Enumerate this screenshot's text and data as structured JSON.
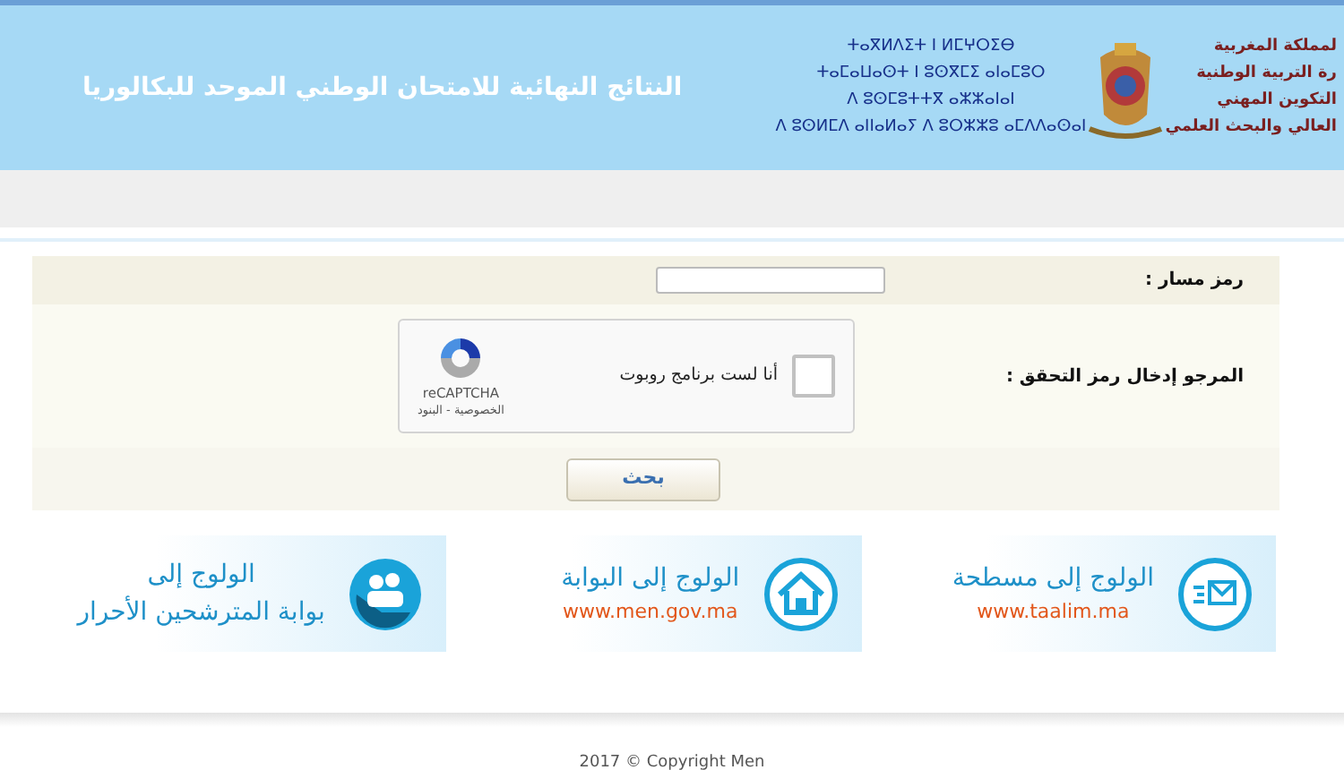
{
  "header": {
    "title": "النتائج النهائية للامتحان الوطني الموحد للبكالوريا",
    "tifinagh_lines": [
      "ⵜⴰⴳⵍⴷⵉⵜ ⵏ ⵍⵎⵖⵔⵉⴱ",
      "ⵜⴰⵎⴰⵡⴰⵙⵜ ⵏ ⵓⵙⴳⵎⵉ ⴰⵏⴰⵎⵓⵔ",
      "ⴷ ⵓⵙⵎⵓⵜⵜⴳ ⴰⵣⵣⴰⵏⴰⵏ",
      "ⴷ ⵓⵙⵍⵎⴷ ⴰⵏⵏⴰⵍⴰⵢ ⴷ ⵓⵔⵣⵣⵓ ⴰⵎⴷⴷⴰⵙⴰⵏ"
    ],
    "arabic_lines": [
      "لمملكة المغربية",
      "رة التربية الوطنية",
      "التكوين المهني",
      "العالي والبحث العلمي"
    ]
  },
  "form": {
    "fields": [
      {
        "kind": "input",
        "label": "رمز مسار :"
      },
      {
        "kind": "captcha",
        "label": "المرجو إدخال رمز التحقق :",
        "captcha": {
          "text": "أنا لست برنامج روبوت",
          "checked": false,
          "brand": "reCAPTCHA",
          "links": "الخصوصية - البنود"
        }
      }
    ],
    "submit": "بحث"
  },
  "banners": [
    {
      "kind": "taalim",
      "title": "الولوج إلى مسطحة",
      "subtitle": "www.taalim.ma"
    },
    {
      "kind": "men",
      "title": "الولوج إلى البوابة",
      "subtitle": "www.men.gov.ma"
    },
    {
      "kind": "candidates",
      "title": "الولوج إلى",
      "subtitle": "بوابة المترشحين الأحرار"
    }
  ],
  "footer": "2017 © Copyright Men"
}
